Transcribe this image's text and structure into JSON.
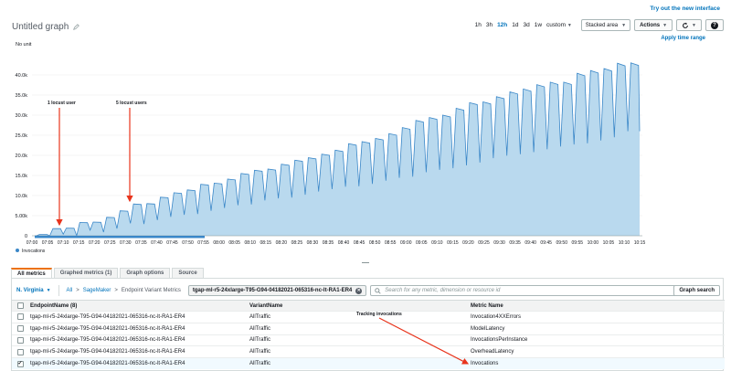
{
  "header": {
    "try_new": "Try out the new interface",
    "title": "Untitled graph",
    "ranges": [
      "1h",
      "3h",
      "12h",
      "1d",
      "3d",
      "1w",
      "custom"
    ],
    "active_range": "12h",
    "chart_type": "Stacked area",
    "actions_label": "Actions",
    "apply_time_range": "Apply time range"
  },
  "chart_data": {
    "type": "area",
    "unit_label": "No unit",
    "ylim": [
      0,
      45000
    ],
    "yticks": [
      {
        "v": 0,
        "t": "0"
      },
      {
        "v": 5000,
        "t": "5.00k"
      },
      {
        "v": 10000,
        "t": "10.0k"
      },
      {
        "v": 15000,
        "t": "15.0k"
      },
      {
        "v": 20000,
        "t": "20.0k"
      },
      {
        "v": 25000,
        "t": "25.0k"
      },
      {
        "v": 30000,
        "t": "30.0k"
      },
      {
        "v": 35000,
        "t": "35.0k"
      },
      {
        "v": 40000,
        "t": "40.0k"
      }
    ],
    "x_labels": [
      "07:00",
      "07:05",
      "07:10",
      "07:15",
      "07:20",
      "07:25",
      "07:30",
      "07:35",
      "07:40",
      "07:45",
      "07:50",
      "07:55",
      "08:00",
      "08:05",
      "08:10",
      "08:15",
      "08:20",
      "08:25",
      "08:30",
      "08:35",
      "08:40",
      "08:45",
      "08:50",
      "08:55",
      "09:00",
      "09:05",
      "09:10",
      "09:15",
      "09:20",
      "09:25",
      "09:30",
      "09:35",
      "09:40",
      "09:45",
      "09:50",
      "09:55",
      "10:00",
      "10:05",
      "10:10",
      "10:15"
    ],
    "series": [
      {
        "name": "Invocations",
        "color": "#3a87c8"
      }
    ],
    "peaks": [
      300,
      1800,
      1900,
      3300,
      3400,
      4600,
      6200,
      7900,
      8000,
      9600,
      10700,
      11400,
      12800,
      13100,
      14100,
      15500,
      16300,
      16600,
      17800,
      18800,
      19400,
      20300,
      21300,
      22900,
      23400,
      24200,
      25400,
      26900,
      28700,
      29400,
      30000,
      31700,
      33100,
      33300,
      34600,
      35800,
      36500,
      37600,
      38200,
      38200,
      40400,
      41100,
      41600,
      42900,
      43000
    ],
    "troughs": [
      0,
      0,
      400,
      0,
      1400,
      900,
      1800,
      3100,
      2900,
      3900,
      4700,
      5200,
      5400,
      6200,
      6900,
      7600,
      7800,
      8800,
      9300,
      9500,
      10200,
      11000,
      11600,
      12200,
      12300,
      12900,
      13700,
      14400,
      14700,
      15800,
      16400,
      16800,
      17500,
      18200,
      19300,
      19900,
      20300,
      20800,
      21500,
      22200,
      22700,
      23000,
      23700,
      24500,
      26000
    ]
  },
  "annotations": {
    "one_user": "1 locust user",
    "five_users": "5 locust users",
    "tracking": "Tracking invocations"
  },
  "tabs": [
    "All metrics",
    "Graphed metrics (1)",
    "Graph options",
    "Source"
  ],
  "browser": {
    "region": "N. Virginia",
    "crumb_all": "All",
    "crumb_ns": "SageMaker",
    "crumb_dim": "Endpoint Variant Metrics",
    "chip": "tgap-ml-r5-24xlarge-T95-G94-04182021-065316-nc-lt-RA1-ER4",
    "search_placeholder": "Search for any metric, dimension or resource id",
    "search_button": "Graph search"
  },
  "table": {
    "headers": [
      "EndpointName (8)",
      "VariantName",
      "Metric Name"
    ],
    "rows": [
      {
        "endpoint": "tgap-ml-r5-24xlarge-T95-G94-04182021-065316-nc-lt-RA1-ER4",
        "variant": "AllTraffic",
        "metric": "Invocation4XXErrors",
        "checked": ""
      },
      {
        "endpoint": "tgap-ml-r5-24xlarge-T95-G94-04182021-065316-nc-lt-RA1-ER4",
        "variant": "AllTraffic",
        "metric": "ModelLatency",
        "checked": ""
      },
      {
        "endpoint": "tgap-ml-r5-24xlarge-T95-G94-04182021-065316-nc-lt-RA1-ER4",
        "variant": "AllTraffic",
        "metric": "InvocationsPerInstance",
        "checked": ""
      },
      {
        "endpoint": "tgap-ml-r5-24xlarge-T95-G94-04182021-065316-nc-lt-RA1-ER4",
        "variant": "AllTraffic",
        "metric": "OverheadLatency",
        "checked": ""
      },
      {
        "endpoint": "tgap-ml-r5-24xlarge-T95-G94-04182021-065316-nc-lt-RA1-ER4",
        "variant": "AllTraffic",
        "metric": "Invocations",
        "checked": "✓"
      }
    ]
  }
}
